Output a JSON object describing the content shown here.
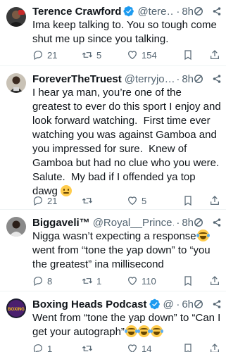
{
  "colors": {
    "text": "#0f1419",
    "muted": "#536471",
    "verified": "#1d9bf0",
    "divider": "#eff3f4"
  },
  "tweets": [
    {
      "name": "Terence Crawford",
      "verified": true,
      "handle": "@tere…",
      "dot": "·",
      "time": "8h",
      "text": "Ima keep talking to. You so tough come shut me up since you talking.",
      "replies": "21",
      "retweets": "5",
      "likes": "154",
      "avatar": "boxer-avatar"
    },
    {
      "name": "ForeverTheTruest",
      "verified": false,
      "handle": "@terryjo…",
      "dot": "·",
      "time": "8h",
      "text": "I hear ya man, you’re one of the greatest to ever do this sport I enjoy and look forward watching.  First time ever watching you was against Gamboa and you impressed for sure.  Knew of Gamboa but had no clue who you were.  Salute.  My bad if I offended ya top dawg",
      "replies": "21",
      "retweets": "",
      "likes": "5",
      "avatar": "man-avatar"
    },
    {
      "name": "Biggaveli™",
      "verified": false,
      "handle": "@Royal__Prince…",
      "dot": "·",
      "time": "8h",
      "text_part1": "Nigga wasn’t expecting a response",
      "text_part2": "went from “tone the yap down” to “you the greatest” ina millisecond",
      "replies": "8",
      "retweets": "1",
      "likes": "110",
      "avatar": "man-avatar"
    },
    {
      "name": "Boxing Heads Podcast",
      "verified": true,
      "handle": "@…",
      "dot": "·",
      "time": "6h",
      "text": "Went from “tone the yap down” to “Can I get your autograph”",
      "replies": "1",
      "retweets": "",
      "likes": "14",
      "avatar": "boxing-logo",
      "avatar_text": "BOXING"
    }
  ]
}
